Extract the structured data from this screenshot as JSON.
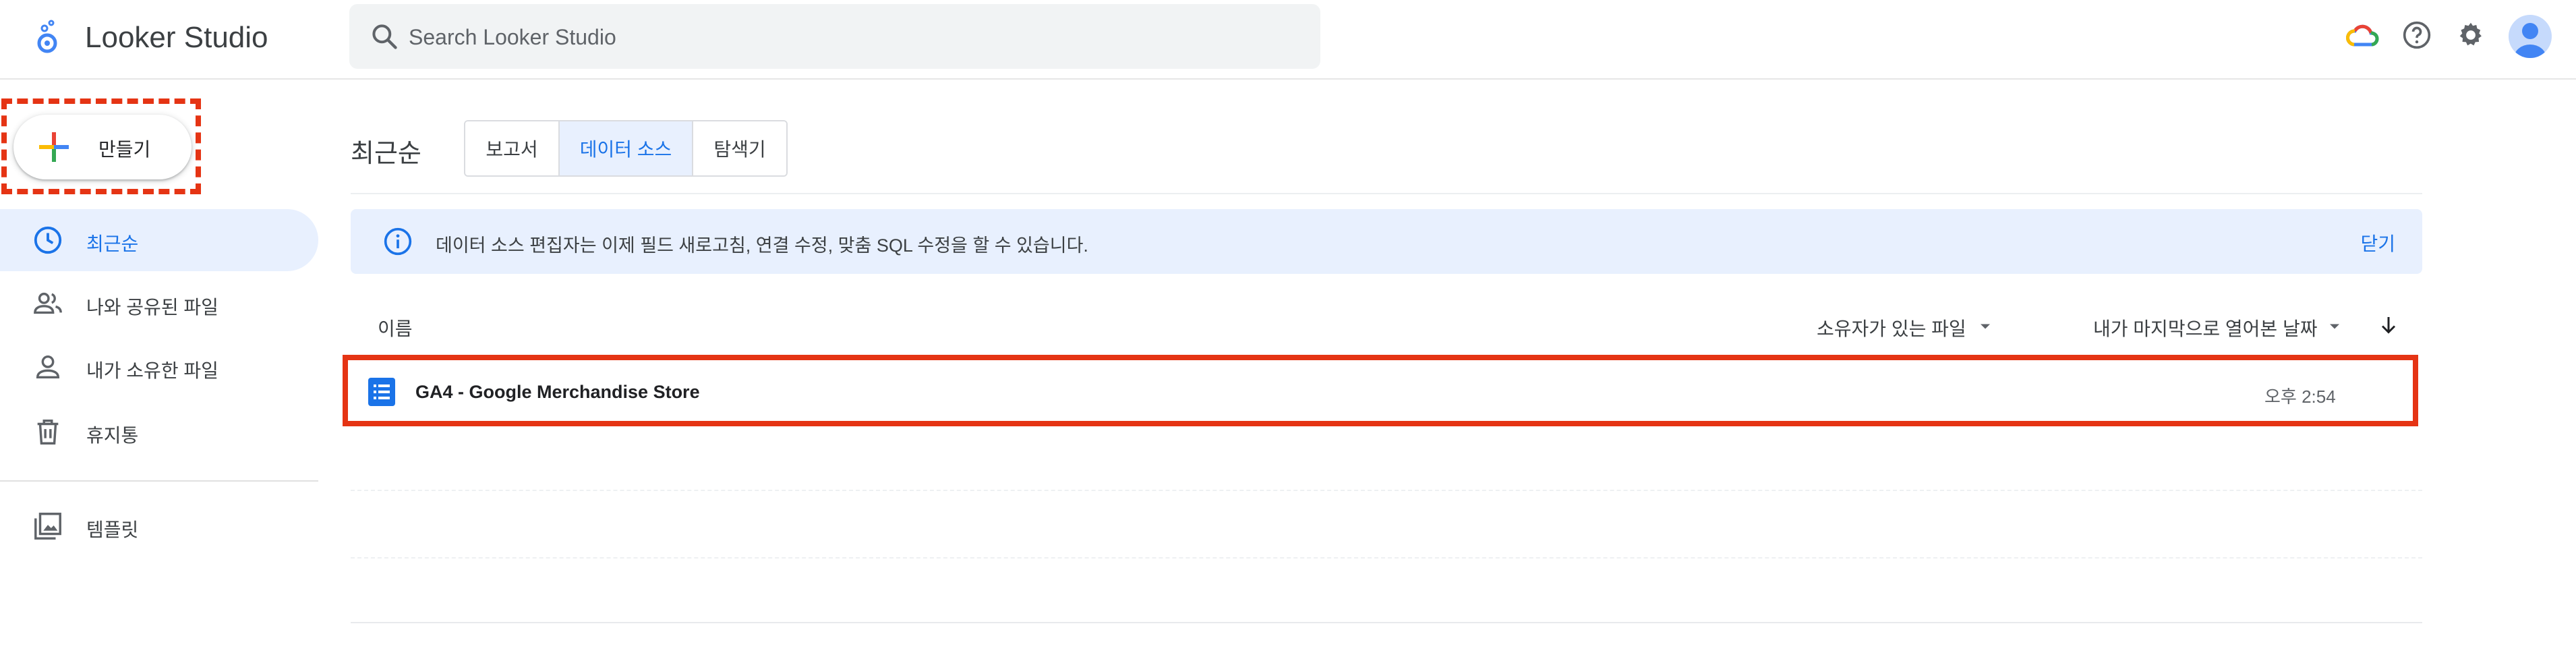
{
  "header": {
    "app_title": "Looker Studio",
    "search_placeholder": "Search Looker Studio",
    "icons": [
      "cloud-icon",
      "help-icon",
      "settings-icon",
      "avatar"
    ]
  },
  "sidebar": {
    "create_label": "만들기",
    "items": [
      {
        "label": "최근순",
        "icon": "clock-icon",
        "active": true
      },
      {
        "label": "나와 공유된 파일",
        "icon": "people-icon",
        "active": false
      },
      {
        "label": "내가 소유한 파일",
        "icon": "person-icon",
        "active": false
      },
      {
        "label": "휴지통",
        "icon": "trash-icon",
        "active": false
      },
      {
        "label": "템플릿",
        "icon": "template-icon",
        "active": false
      }
    ]
  },
  "main": {
    "section_title": "최근순",
    "tabs": [
      {
        "label": "보고서",
        "active": false
      },
      {
        "label": "데이터 소스",
        "active": true
      },
      {
        "label": "탐색기",
        "active": false
      }
    ],
    "banner": {
      "message": "데이터 소스 편집자는 이제 필드 새로고침, 연결 수정, 맞춤 SQL 수정을 할 수 있습니다.",
      "close_label": "닫기"
    },
    "columns": {
      "name": "이름",
      "owner": "소유자가 있는 파일",
      "last_opened": "내가 마지막으로 열어본 날짜"
    },
    "rows": [
      {
        "name": "GA4 - Google Merchandise Store",
        "time": "오후 2:54"
      }
    ]
  },
  "colors": {
    "accent": "#1a73e8",
    "active_bg": "#e8f0fe",
    "highlight": "#e53414"
  }
}
